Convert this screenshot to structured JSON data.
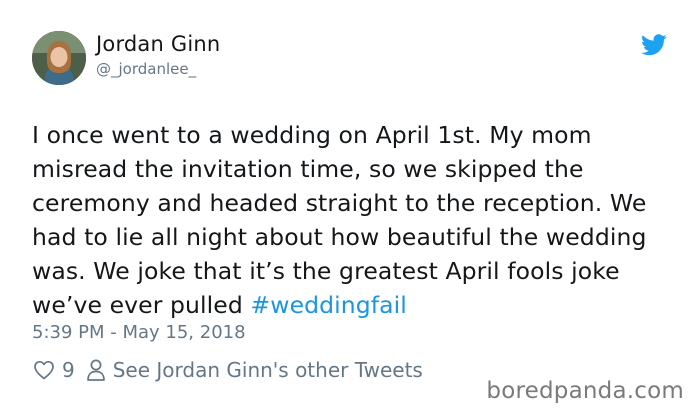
{
  "user": {
    "name": "Jordan Ginn",
    "handle": "@_jordanlee_"
  },
  "tweet": {
    "text": "I once went to a wedding on April 1st. My mom misread the invitation time, so we skipped the ceremony and headed straight to the reception. We had to lie all night about how beautiful the wedding was. We joke that it’s the greatest April fools joke we’ve ever pulled ",
    "hashtag": "#weddingfail",
    "timestamp": "5:39 PM - May 15, 2018"
  },
  "actions": {
    "like_count": "9",
    "other_tweets_label": "See Jordan Ginn's other Tweets"
  },
  "watermark": "boredpanda.com",
  "colors": {
    "accent": "#1b95e0",
    "muted": "#657786",
    "text": "#14171a"
  },
  "icons": {
    "brand": "twitter-bird-icon",
    "like": "heart-icon",
    "profile": "person-icon"
  }
}
